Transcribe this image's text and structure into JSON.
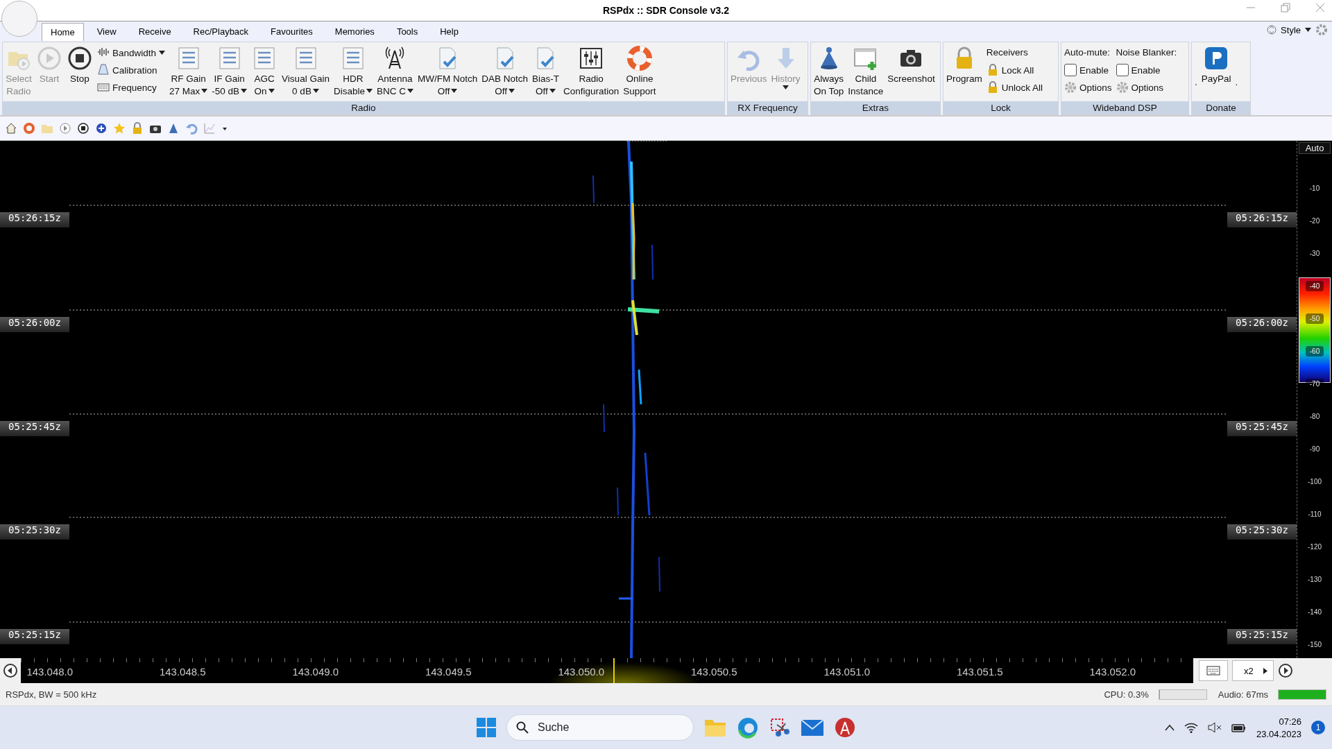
{
  "window": {
    "title": "RSPdx :: SDR Console v3.2"
  },
  "menu_tabs": [
    {
      "label": "Home",
      "selected": true
    },
    {
      "label": "View",
      "selected": false
    },
    {
      "label": "Receive",
      "selected": false
    },
    {
      "label": "Rec/Playback",
      "selected": false
    },
    {
      "label": "Favourites",
      "selected": false
    },
    {
      "label": "Memories",
      "selected": false
    },
    {
      "label": "Tools",
      "selected": false
    },
    {
      "label": "Help",
      "selected": false
    }
  ],
  "style_menu": "Style",
  "ribbon_groups": [
    {
      "label": "Radio",
      "items": [
        {
          "kind": "large",
          "lines": [
            "Select",
            "Radio"
          ],
          "dropdown": false,
          "disabled": true
        },
        {
          "kind": "large",
          "lines": [
            "Start"
          ],
          "dropdown": false,
          "disabled": true
        },
        {
          "kind": "large",
          "lines": [
            "Stop"
          ],
          "dropdown": false,
          "disabled": false
        },
        {
          "kind": "stack",
          "children": [
            {
              "kind": "small",
              "label": "Bandwidth",
              "dropdown": true
            },
            {
              "kind": "small",
              "label": "Calibration",
              "dropdown": false
            },
            {
              "kind": "small",
              "label": "Frequency",
              "dropdown": false
            }
          ]
        },
        {
          "kind": "large",
          "lines": [
            "RF Gain",
            "27 Max"
          ],
          "dropdown": true,
          "disabled": false
        },
        {
          "kind": "large",
          "lines": [
            "IF Gain",
            "-50 dB"
          ],
          "dropdown": true,
          "disabled": false
        },
        {
          "kind": "large",
          "lines": [
            "AGC",
            "On"
          ],
          "dropdown": true,
          "disabled": false
        },
        {
          "kind": "large",
          "lines": [
            "Visual Gain",
            "0 dB"
          ],
          "dropdown": true,
          "disabled": false
        },
        {
          "kind": "large",
          "lines": [
            "HDR",
            "Disable"
          ],
          "dropdown": true,
          "disabled": false
        },
        {
          "kind": "large",
          "lines": [
            "Antenna",
            "BNC C"
          ],
          "dropdown": true,
          "disabled": false
        },
        {
          "kind": "large",
          "lines": [
            "MW/FM Notch",
            "Off"
          ],
          "dropdown": true,
          "disabled": false
        },
        {
          "kind": "large",
          "lines": [
            "DAB Notch",
            "Off"
          ],
          "dropdown": true,
          "disabled": false
        },
        {
          "kind": "large",
          "lines": [
            "Bias-T",
            "Off"
          ],
          "dropdown": true,
          "disabled": false
        },
        {
          "kind": "large",
          "lines": [
            "Radio",
            "Configuration"
          ],
          "dropdown": false,
          "disabled": false
        },
        {
          "kind": "large",
          "lines": [
            "Online",
            "Support"
          ],
          "dropdown": false,
          "disabled": false
        }
      ]
    },
    {
      "label": "RX Frequency",
      "items": [
        {
          "kind": "large",
          "lines": [
            "Previous"
          ],
          "dropdown": false,
          "disabled": true
        },
        {
          "kind": "large",
          "lines": [
            "History"
          ],
          "dropdown": true,
          "disabled": true
        }
      ]
    },
    {
      "label": "Extras",
      "items": [
        {
          "kind": "large",
          "lines": [
            "Always",
            "On Top"
          ],
          "dropdown": false,
          "disabled": false
        },
        {
          "kind": "large",
          "lines": [
            "Child",
            "Instance"
          ],
          "dropdown": false,
          "disabled": false
        },
        {
          "kind": "large",
          "lines": [
            "Screenshot"
          ],
          "dropdown": false,
          "disabled": false
        }
      ]
    },
    {
      "label": "Lock",
      "items": [
        {
          "kind": "large",
          "lines": [
            "Program"
          ],
          "dropdown": false,
          "disabled": false
        },
        {
          "kind": "stack",
          "children": [
            {
              "kind": "heading",
              "label": "Receivers"
            },
            {
              "kind": "small",
              "label": "Lock All",
              "dropdown": false
            },
            {
              "kind": "small",
              "label": "Unlock All",
              "dropdown": false
            }
          ]
        }
      ]
    },
    {
      "label": "Wideband DSP",
      "items": [
        {
          "kind": "stack",
          "children": [
            {
              "kind": "heading",
              "label": "Auto-mute:"
            },
            {
              "kind": "check",
              "label": "Enable",
              "checked": false
            },
            {
              "kind": "small",
              "label": "Options",
              "dropdown": false
            }
          ]
        },
        {
          "kind": "stack",
          "children": [
            {
              "kind": "heading",
              "label": "Noise Blanker:"
            },
            {
              "kind": "check",
              "label": "Enable",
              "checked": false
            },
            {
              "kind": "small",
              "label": "Options",
              "dropdown": false
            }
          ]
        }
      ]
    },
    {
      "label": "Donate",
      "items": [
        {
          "kind": "mark",
          "label": "."
        },
        {
          "kind": "large",
          "lines": [
            "PayPal"
          ],
          "dropdown": false,
          "disabled": false
        },
        {
          "kind": "mark",
          "label": "."
        }
      ]
    }
  ],
  "waterfall": {
    "left_time_labels": [
      "05:26:15z",
      "05:26:00z",
      "05:25:45z",
      "05:25:30z",
      "05:25:15z"
    ],
    "right_time_labels": [
      "05:26:15z",
      "05:26:00z",
      "05:25:45z",
      "05:25:30z",
      "05:25:15z"
    ],
    "scale_button": "Auto",
    "scale_ticks": [
      {
        "label": "-10",
        "in_band": false
      },
      {
        "label": "-20",
        "in_band": false
      },
      {
        "label": "-30",
        "in_band": false
      },
      {
        "label": "-40",
        "in_band": true
      },
      {
        "label": "-50",
        "in_band": true
      },
      {
        "label": "-60",
        "in_band": true
      },
      {
        "label": "-70",
        "in_band": true
      },
      {
        "label": "-80",
        "in_band": false
      },
      {
        "label": "-90",
        "in_band": false
      },
      {
        "label": "-100",
        "in_band": false
      },
      {
        "label": "-110",
        "in_band": false
      },
      {
        "label": "-120",
        "in_band": false
      },
      {
        "label": "-130",
        "in_band": false
      },
      {
        "label": "-140",
        "in_band": false
      },
      {
        "label": "-150",
        "in_band": false
      }
    ]
  },
  "frequency_axis": {
    "labels": [
      "143.048.0",
      "143.048.5",
      "143.049.0",
      "143.049.5",
      "143.050.0",
      "143.050.5",
      "143.051.0",
      "143.051.5",
      "143.052.0"
    ],
    "zoom": "x2"
  },
  "status_bar": {
    "info": "RSPdx, BW = 500 kHz",
    "cpu_meter": {
      "label": "CPU: 0.3%",
      "level": 0.003
    },
    "audio_meter": {
      "label": "Audio: 67ms",
      "level": 1.0
    }
  },
  "taskbar": {
    "search_placeholder": "Suche",
    "time": "07:26",
    "date": "23.04.2023",
    "notification_count": "1"
  }
}
